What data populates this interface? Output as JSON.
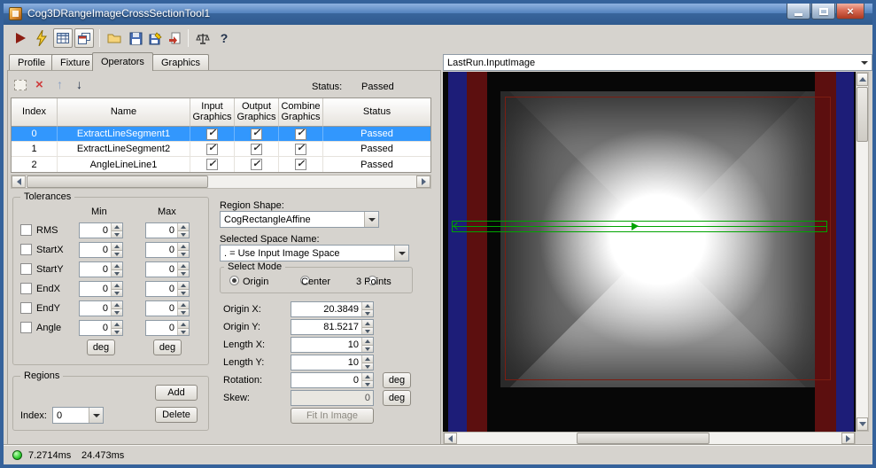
{
  "window": {
    "title": "Cog3DRangeImageCrossSectionTool1"
  },
  "icons": {
    "close": "×",
    "check": "✓",
    "delete_x": "×",
    "up_arrow": "↑",
    "down_arrow": "↓",
    "help": "?"
  },
  "tabs": {
    "items": [
      "Profile",
      "Fixture",
      "Operators",
      "Graphics"
    ],
    "active": "Operators"
  },
  "operators": {
    "status_label": "Status:",
    "status_value": "Passed",
    "table": {
      "headers": [
        "Index",
        "Name",
        "Input Graphics",
        "Output Graphics",
        "Combine Graphics",
        "Status"
      ],
      "rows": [
        {
          "index": "0",
          "name": "ExtractLineSegment1",
          "input_graphics": true,
          "output_graphics": true,
          "combine_graphics": true,
          "status": "Passed",
          "selected": true
        },
        {
          "index": "1",
          "name": "ExtractLineSegment2",
          "input_graphics": true,
          "output_graphics": true,
          "combine_graphics": true,
          "status": "Passed",
          "selected": false
        },
        {
          "index": "2",
          "name": "AngleLineLine1",
          "input_graphics": true,
          "output_graphics": true,
          "combine_graphics": true,
          "status": "Passed",
          "selected": false
        }
      ]
    }
  },
  "tolerances": {
    "title": "Tolerances",
    "min_label": "Min",
    "max_label": "Max",
    "deg": "deg",
    "rows": [
      {
        "label": "RMS",
        "min": "0",
        "max": "0",
        "checked": false
      },
      {
        "label": "StartX",
        "min": "0",
        "max": "0",
        "checked": false
      },
      {
        "label": "StartY",
        "min": "0",
        "max": "0",
        "checked": false
      },
      {
        "label": "EndX",
        "min": "0",
        "max": "0",
        "checked": false
      },
      {
        "label": "EndY",
        "min": "0",
        "max": "0",
        "checked": false
      },
      {
        "label": "Angle",
        "min": "0",
        "max": "0",
        "checked": false
      }
    ]
  },
  "region": {
    "shape_label": "Region Shape:",
    "shape_value": "CogRectangleAffine",
    "space_label": "Selected Space Name:",
    "space_value": ". = Use Input Image Space",
    "mode_label": "Select Mode",
    "modes": [
      "Origin",
      "Center",
      "3 Points"
    ],
    "selected_mode": "Origin",
    "deg": "deg",
    "fields": [
      {
        "label": "Origin X:",
        "value": "20.3849"
      },
      {
        "label": "Origin Y:",
        "value": "81.5217"
      },
      {
        "label": "Length X:",
        "value": "10"
      },
      {
        "label": "Length Y:",
        "value": "10"
      },
      {
        "label": "Rotation:",
        "value": "0"
      },
      {
        "label": "Skew:",
        "value": "0",
        "disabled": true
      }
    ],
    "fit_button": "Fit In Image"
  },
  "regions": {
    "title": "Regions",
    "add_button": "Add",
    "delete_button": "Delete",
    "index_label": "Index:",
    "index_value": "0"
  },
  "display": {
    "source": "LastRun.InputImage"
  },
  "statusbar": {
    "time1": "7.2714ms",
    "time2": "24.473ms"
  },
  "colors": {
    "selection": "#3297fd",
    "image_stripe_blue": "#1d1d78",
    "image_stripe_red": "#5c0f0f",
    "overlay_red": "#7c1d12",
    "overlay_green": "#00a400",
    "led_green": "#2fcf2f"
  }
}
